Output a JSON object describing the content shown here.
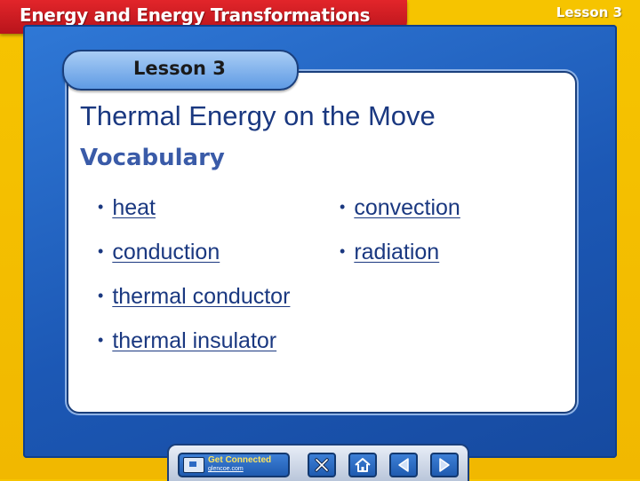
{
  "header": {
    "course_title": "Energy and Energy Transformations",
    "corner_label": "Lesson 3"
  },
  "lesson_tab": {
    "label": "Lesson 3"
  },
  "slide": {
    "title": "Thermal Energy on the Move",
    "section_heading": "Vocabulary"
  },
  "vocabulary": {
    "bullet": "•",
    "left_column": [
      "heat",
      "conduction",
      "thermal conductor",
      "thermal insulator"
    ],
    "right_column": [
      "convection",
      "radiation"
    ]
  },
  "nav": {
    "get_connected_label": "Get Connected",
    "get_connected_sub": "glencoe.com",
    "icons": [
      "close-icon",
      "home-icon",
      "previous-icon",
      "next-icon"
    ]
  },
  "colors": {
    "background_yellow": "#f6c400",
    "header_red": "#e2252a",
    "frame_blue": "#1c58b5",
    "text_navy": "#1a3880"
  }
}
